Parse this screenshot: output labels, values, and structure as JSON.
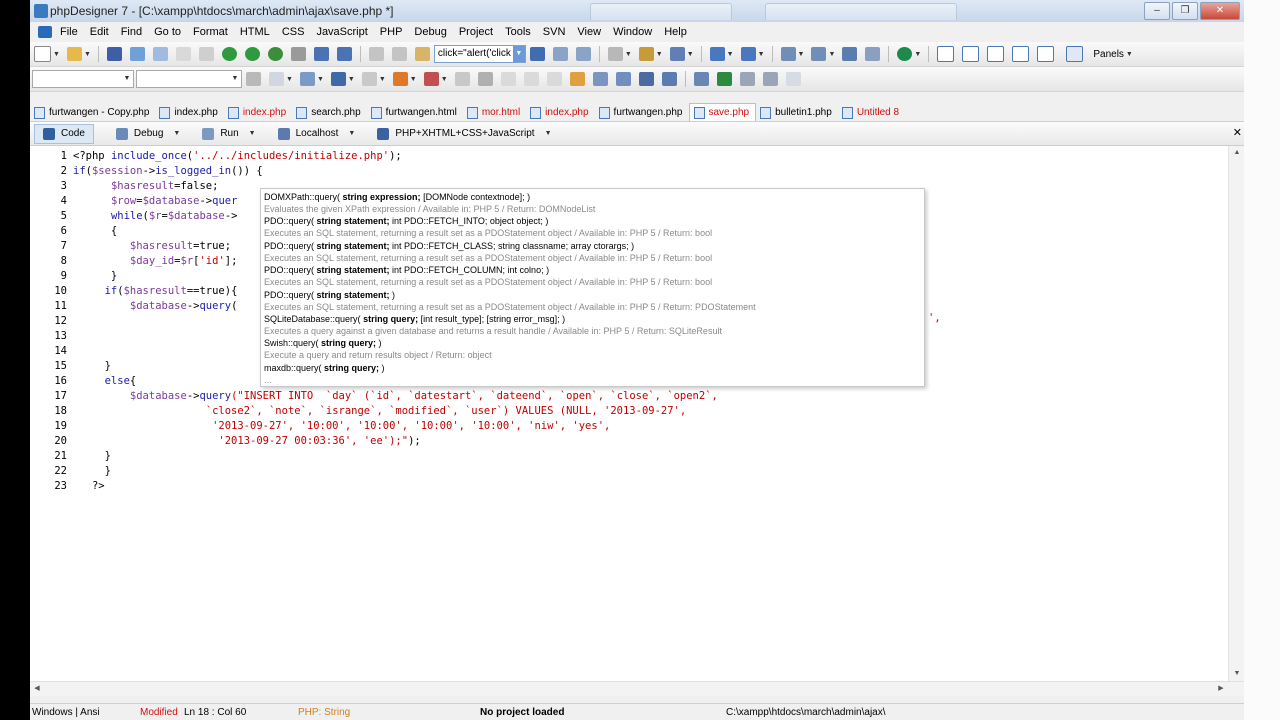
{
  "window": {
    "title": "phpDesigner 7 - [C:\\xampp\\htdocs\\march\\admin\\ajax\\save.php *]",
    "minimize": "–",
    "maximize": "❐",
    "close": "✕"
  },
  "menu": [
    "File",
    "Edit",
    "Find",
    "Go to",
    "Format",
    "HTML",
    "CSS",
    "JavaScript",
    "PHP",
    "Debug",
    "Project",
    "Tools",
    "SVN",
    "View",
    "Window",
    "Help"
  ],
  "toolbar": {
    "snippet_value": "click=\"alert('click",
    "panels_label": "Panels"
  },
  "tabs": [
    {
      "label": "furtwangen - Copy.php",
      "red": false,
      "active": false
    },
    {
      "label": "index.php",
      "red": false,
      "active": false
    },
    {
      "label": "index.php",
      "red": true,
      "active": false
    },
    {
      "label": "search.php",
      "red": false,
      "active": false
    },
    {
      "label": "furtwangen.html",
      "red": false,
      "active": false
    },
    {
      "label": "mor.html",
      "red": true,
      "active": false
    },
    {
      "label": "index.php",
      "red": true,
      "active": false
    },
    {
      "label": "furtwangen.php",
      "red": false,
      "active": false
    },
    {
      "label": "save.php",
      "red": true,
      "active": true
    },
    {
      "label": "bulletin1.php",
      "red": false,
      "active": false
    },
    {
      "label": "Untitled 8",
      "red": true,
      "active": false
    }
  ],
  "subtoolbar": {
    "code": "Code",
    "debug": "Debug",
    "run": "Run",
    "localhost": "Localhost",
    "mode": "PHP+XHTML+CSS+JavaScript",
    "close": "✕"
  },
  "code_lines": [
    {
      "n": "1",
      "segs": [
        [
          "pl",
          "<?php "
        ],
        [
          "kw",
          "include_once"
        ],
        [
          "pl",
          "("
        ],
        [
          "st",
          "'../../includes/initialize.php'"
        ],
        [
          "pl",
          ");"
        ]
      ]
    },
    {
      "n": "2",
      "segs": [
        [
          "kw",
          "if"
        ],
        [
          "pl",
          "("
        ],
        [
          "vr",
          "$session"
        ],
        [
          "pl",
          "->"
        ],
        [
          "fn",
          "is_logged_in"
        ],
        [
          "pl",
          "()) {"
        ]
      ]
    },
    {
      "n": "3",
      "segs": [
        [
          "pl",
          "      "
        ],
        [
          "vr",
          "$hasresult"
        ],
        [
          "pl",
          "=false;"
        ]
      ]
    },
    {
      "n": "4",
      "segs": [
        [
          "pl",
          "      "
        ],
        [
          "vr",
          "$row"
        ],
        [
          "pl",
          "="
        ],
        [
          "vr",
          "$database"
        ],
        [
          "pl",
          "->"
        ],
        [
          "fn",
          "quer"
        ]
      ]
    },
    {
      "n": "5",
      "segs": [
        [
          "pl",
          "      "
        ],
        [
          "kw",
          "while"
        ],
        [
          "pl",
          "("
        ],
        [
          "vr",
          "$r"
        ],
        [
          "pl",
          "="
        ],
        [
          "vr",
          "$database"
        ],
        [
          "pl",
          "->"
        ]
      ]
    },
    {
      "n": "6",
      "segs": [
        [
          "pl",
          "      {"
        ]
      ]
    },
    {
      "n": "7",
      "segs": [
        [
          "pl",
          "         "
        ],
        [
          "vr",
          "$hasresult"
        ],
        [
          "pl",
          "=true;"
        ]
      ]
    },
    {
      "n": "8",
      "segs": [
        [
          "pl",
          "         "
        ],
        [
          "vr",
          "$day_id"
        ],
        [
          "pl",
          "="
        ],
        [
          "vr",
          "$r"
        ],
        [
          "pl",
          "["
        ],
        [
          "st",
          "'id'"
        ],
        [
          "pl",
          "];"
        ]
      ]
    },
    {
      "n": "9",
      "segs": [
        [
          "pl",
          "      }"
        ]
      ]
    },
    {
      "n": "10",
      "segs": [
        [
          "pl",
          "     "
        ],
        [
          "kw",
          "if"
        ],
        [
          "pl",
          "("
        ],
        [
          "vr",
          "$hasresult"
        ],
        [
          "pl",
          "==true){"
        ]
      ]
    },
    {
      "n": "11",
      "segs": [
        [
          "pl",
          "         "
        ],
        [
          "vr",
          "$database"
        ],
        [
          "pl",
          "->"
        ],
        [
          "fn",
          "query"
        ],
        [
          "pl",
          "("
        ]
      ]
    },
    {
      "n": "12",
      "segs": [
        [
          "pl",
          ""
        ]
      ]
    },
    {
      "n": "13",
      "segs": [
        [
          "pl",
          ""
        ]
      ]
    },
    {
      "n": "14",
      "segs": [
        [
          "pl",
          ""
        ]
      ]
    },
    {
      "n": "15",
      "segs": [
        [
          "pl",
          "     }"
        ]
      ]
    },
    {
      "n": "16",
      "segs": [
        [
          "pl",
          "     "
        ],
        [
          "kw",
          "else"
        ],
        [
          "pl",
          "{"
        ]
      ]
    },
    {
      "n": "17",
      "segs": [
        [
          "pl",
          "         "
        ],
        [
          "vr",
          "$database"
        ],
        [
          "pl",
          "->"
        ],
        [
          "fn",
          "query"
        ],
        [
          "st",
          "(\"INSERT INTO  `day` (`id`, `datestart`, `dateend`, `open`, `close`, `open2`,"
        ]
      ]
    },
    {
      "n": "18",
      "segs": [
        [
          "pl",
          "                     "
        ],
        [
          "st",
          "`close2`, `note`, `isrange`, `modified`, `user`) VALUES (NULL, '2013-09-27',"
        ]
      ]
    },
    {
      "n": "19",
      "segs": [
        [
          "pl",
          "                      "
        ],
        [
          "st",
          "'2013-09-27', '10:00', '10:00', '10:00', '10:00', 'niw', 'yes',"
        ]
      ]
    },
    {
      "n": "20",
      "segs": [
        [
          "pl",
          "                       "
        ],
        [
          "st",
          "'2013-09-27 00:03:36', 'ee');\""
        ],
        [
          "pl",
          ");"
        ]
      ]
    },
    {
      "n": "21",
      "segs": [
        [
          "pl",
          "     }"
        ]
      ]
    },
    {
      "n": "22",
      "segs": [
        [
          "pl",
          "     }"
        ]
      ]
    },
    {
      "n": "23",
      "segs": [
        [
          "pl",
          "   ?>"
        ]
      ]
    }
  ],
  "line12_tail": "',",
  "popup": [
    {
      "sig_a": "DOMXPath::query( ",
      "sig_b": "string expression;",
      "sig_c": " [DOMNode contextnode]; )",
      "desc": "Evaluates the given XPath expression / Available in: PHP 5 / Return: DOMNodeList"
    },
    {
      "sig_a": "PDO::query( ",
      "sig_b": "string statement;",
      "sig_c": " int PDO::FETCH_INTO; object object; )",
      "desc": "Executes an SQL statement, returning a result set as a PDOStatement object / Available in: PHP 5 / Return: bool"
    },
    {
      "sig_a": "PDO::query( ",
      "sig_b": "string statement;",
      "sig_c": " int PDO::FETCH_CLASS; string classname; array ctorargs; )",
      "desc": "Executes an SQL statement, returning a result set as a PDOStatement object / Available in: PHP 5 / Return: bool"
    },
    {
      "sig_a": "PDO::query( ",
      "sig_b": "string statement;",
      "sig_c": " int PDO::FETCH_COLUMN; int colno; )",
      "desc": "Executes an SQL statement, returning a result set as a PDOStatement object / Available in: PHP 5 / Return: bool"
    },
    {
      "sig_a": "PDO::query( ",
      "sig_b": "string statement;",
      "sig_c": " )",
      "desc": "Executes an SQL statement, returning a result set as a PDOStatement object / Available in: PHP 5 / Return: PDOStatement"
    },
    {
      "sig_a": "SQLiteDatabase::query( ",
      "sig_b": "string query;",
      "sig_c": " [int result_type]; [string error_msg]; )",
      "desc": "Executes a query against a given database and returns a result handle / Available in: PHP 5 / Return: SQLiteResult"
    },
    {
      "sig_a": "Swish::query( ",
      "sig_b": "string query;",
      "sig_c": " )",
      "desc": "Execute a query and return results object / Return: object"
    },
    {
      "sig_a": "maxdb::query( ",
      "sig_b": "string query;",
      "sig_c": " )",
      "desc": "..."
    }
  ],
  "status": {
    "encoding": "Windows | Ansi",
    "modified": "Modified",
    "position": "Ln    18 : Col  60",
    "context": "PHP: String",
    "project": "No project loaded",
    "path": "C:\\xampp\\htdocs\\march\\admin\\ajax\\"
  },
  "colors": {
    "keyword": "#1a1aa6",
    "variable": "#7a3a9a",
    "string": "#c00000",
    "modified_tab": "#d01010"
  }
}
